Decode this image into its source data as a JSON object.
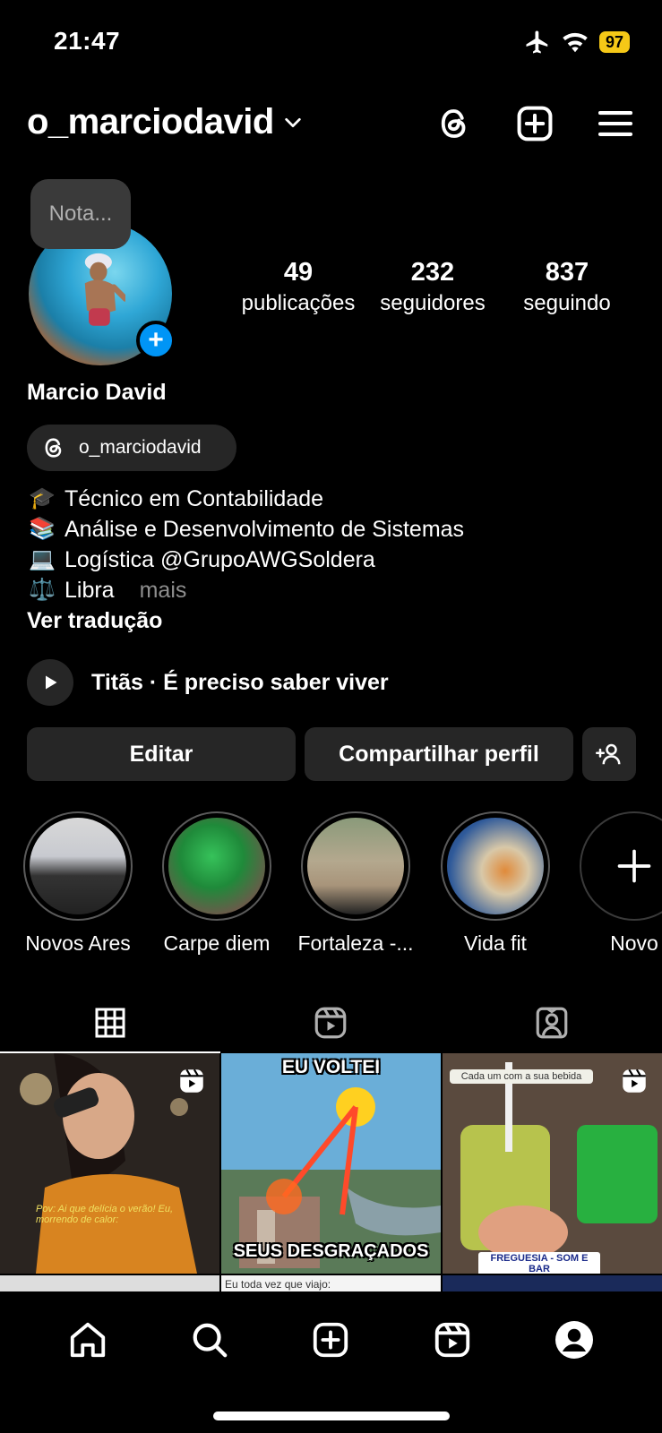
{
  "status_bar": {
    "time": "21:47",
    "battery": "97",
    "icons": [
      "airplane-icon",
      "wifi-icon",
      "battery-icon"
    ]
  },
  "header": {
    "username": "o_marciodavid",
    "icons": [
      "chevron-down-icon",
      "threads-icon",
      "create-icon",
      "menu-icon"
    ]
  },
  "profile": {
    "note_placeholder": "Nota...",
    "full_name": "Marcio David",
    "threads_handle": "o_marciodavid",
    "stats": [
      {
        "value": "49",
        "label": "publicações"
      },
      {
        "value": "232",
        "label": "seguidores"
      },
      {
        "value": "837",
        "label": "seguindo"
      }
    ],
    "bio": [
      {
        "emoji": "🎓",
        "text": "Técnico em Contabilidade"
      },
      {
        "emoji": "📚",
        "text": "Análise e Desenvolvimento de Sistemas"
      },
      {
        "emoji": "💻",
        "text": "Logística @GrupoAWGSoldera"
      },
      {
        "emoji": "⚖️",
        "text": "Libra"
      }
    ],
    "more_label": "mais",
    "translate_label": "Ver tradução",
    "music": "Titãs · É preciso saber viver"
  },
  "actions": {
    "edit_label": "Editar",
    "share_label": "Compartilhar perfil"
  },
  "highlights": [
    {
      "label": "Novos Ares"
    },
    {
      "label": "Carpe diem"
    },
    {
      "label": "Fortaleza -..."
    },
    {
      "label": "Vida fit"
    },
    {
      "label": "Novo"
    }
  ],
  "tabs": [
    "grid-icon",
    "reels-icon",
    "tagged-icon"
  ],
  "grid": {
    "post2_top": "EU VOLTEI",
    "post2_bottom": "SEUS DESGRAÇADOS",
    "post3_caption": "Cada um com a sua bebida",
    "post3_location": "FREGUESIA - SOM E BAR",
    "post1_caption": "Pov: Ai que delícia o verão! Eu, morrendo de calor:",
    "row2_caption": "Eu toda vez que viajo:"
  },
  "bottom_nav": [
    "home-icon",
    "search-icon",
    "create-icon",
    "reels-icon",
    "profile-icon"
  ],
  "colors": {
    "background": "#000000",
    "surface": "#262626",
    "accent": "#0095f6",
    "battery": "#f5c817"
  }
}
